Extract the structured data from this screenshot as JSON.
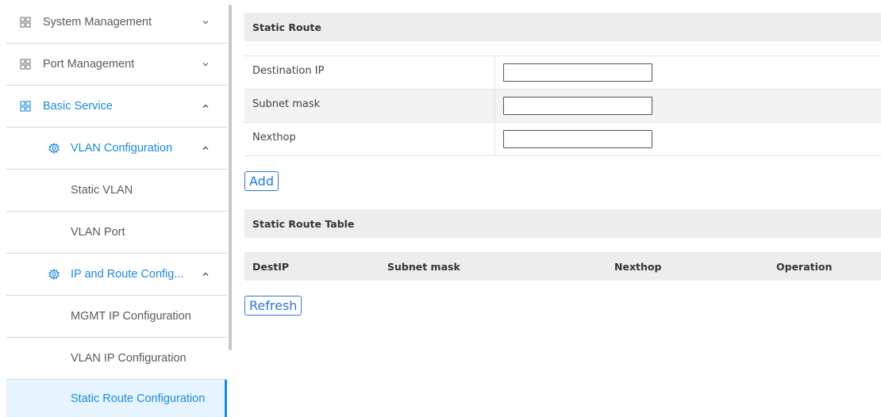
{
  "sidebar": {
    "items": [
      {
        "label": "System Management",
        "icon": "grid-icon",
        "chevron": "down"
      },
      {
        "label": "Port Management",
        "icon": "grid-icon",
        "chevron": "down"
      },
      {
        "label": "Basic Service",
        "icon": "grid-icon",
        "chevron": "up"
      },
      {
        "label": "VLAN Configuration",
        "icon": "gear-icon",
        "chevron": "up"
      },
      {
        "label": "Static VLAN"
      },
      {
        "label": "VLAN Port"
      },
      {
        "label": "IP and Route Config...",
        "icon": "gear-icon",
        "chevron": "up"
      },
      {
        "label": "MGMT IP Configuration"
      },
      {
        "label": "VLAN IP Configuration"
      },
      {
        "label": "Static Route Configuration"
      }
    ]
  },
  "static_route": {
    "title": "Static Route",
    "fields": [
      {
        "label": "Destination IP",
        "value": ""
      },
      {
        "label": "Subnet mask",
        "value": ""
      },
      {
        "label": "Nexthop",
        "value": ""
      }
    ],
    "add_label": "Add"
  },
  "route_table": {
    "title": "Static Route Table",
    "columns": [
      "DestIP",
      "Subnet mask",
      "Nexthop",
      "Operation"
    ],
    "refresh_label": "Refresh"
  },
  "colors": {
    "accent": "#1a8bd8",
    "header_bg": "#ededed",
    "selected_bg": "#e6f4ff"
  }
}
